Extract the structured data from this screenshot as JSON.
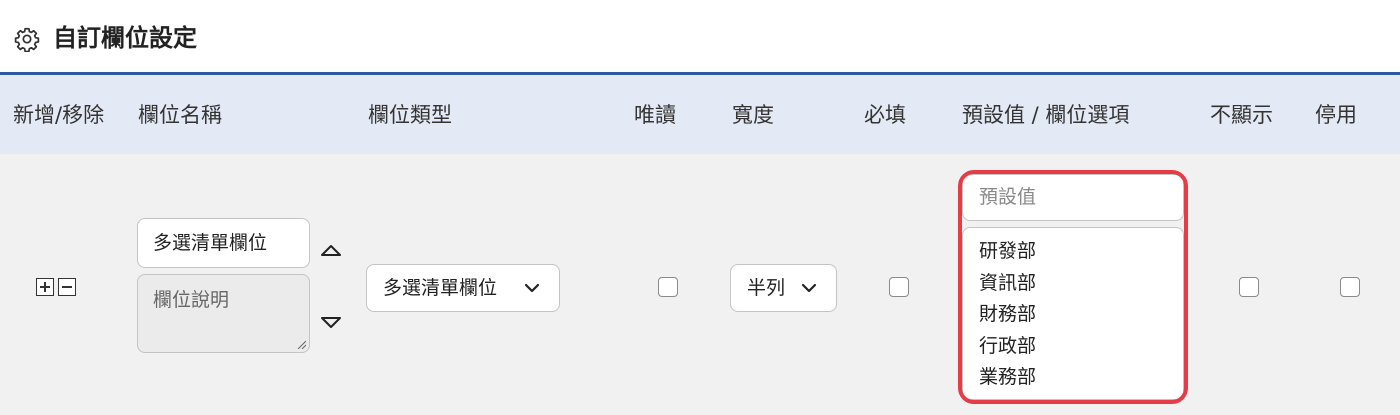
{
  "header": {
    "icon": "gear-icon",
    "title": "自訂欄位設定"
  },
  "table": {
    "header_bg": "#e4eaf5",
    "accent": "#2a5aa5",
    "columns": [
      "新增/移除",
      "欄位名稱",
      "欄位類型",
      "唯讀",
      "寬度",
      "必填",
      "預設值 / 欄位選項",
      "不顯示",
      "停用"
    ]
  },
  "row": {
    "field_name": "多選清單欄位",
    "description_placeholder": "欄位說明",
    "field_type": "多選清單欄位",
    "readonly": false,
    "width": "半列",
    "required": false,
    "default_placeholder": "預設值",
    "options": [
      "研發部",
      "資訊部",
      "財務部",
      "行政部",
      "業務部"
    ],
    "hidden": false,
    "disabled": false
  },
  "highlight_color": "#e53c47"
}
